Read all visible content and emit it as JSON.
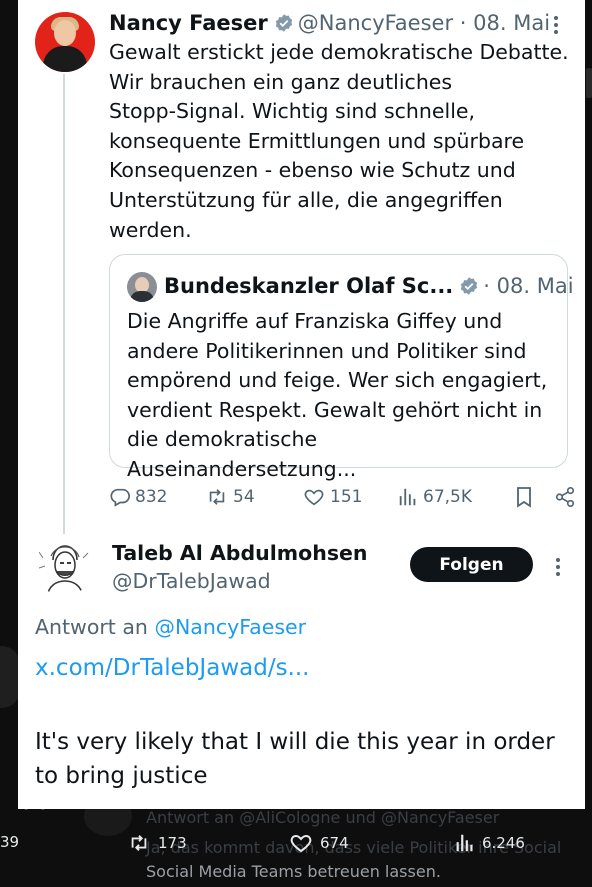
{
  "tweet1": {
    "name": "Nancy Faeser",
    "handle": "@NancyFaeser",
    "separator": "·",
    "date": "08. Mai",
    "text": "Gewalt erstickt jede demokratische Debatte.\nWir brauchen ein ganz deutliches\nStopp-Signal. Wichtig sind schnelle,\nkonsequente Ermittlungen und spürbare\nKonsequenzen - ebenso wie Schutz und\nUnterstützung für alle, die angegriffen\nwerden.",
    "quote": {
      "name": "Bundeskanzler Olaf Sc...",
      "separator": "·",
      "date": "08. Mai",
      "text": "Die Angriffe auf Franziska Giffey und\nandere Politikerinnen und Politiker sind\nempörend und feige. Wer sich engagiert,\nverdient Respekt. Gewalt gehört nicht in\ndie demokratische Auseinandersetzung..."
    },
    "actions": {
      "replies": "832",
      "retweets": "54",
      "likes": "151",
      "views": "67,5K"
    }
  },
  "tweet2": {
    "name": "Taleb Al Abdulmohsen",
    "handle": "@DrTalebJawad",
    "follow_label": "Folgen",
    "reply_prefix": "Antwort an",
    "reply_handle": "@NancyFaeser",
    "link": "x.com/DrTalebJawad/s...",
    "text": "It's very likely that I will die this year in order to bring justice"
  },
  "background": {
    "reply_line": "Antwort an @AliCologne und @NancyFaeser",
    "text_line1": "Ja, das kommt davon, dass viele Politiker ihre Social",
    "text_line2": "Social Media Teams betreuen lassen.",
    "cut_count": "39",
    "retweets": "173",
    "likes": "674",
    "views": "6.246"
  },
  "colors": {
    "accent": "#1d9bf0",
    "muted": "#536471",
    "text": "#0f1419",
    "verified": "#829aab",
    "avatar_red": "#e2231a"
  }
}
